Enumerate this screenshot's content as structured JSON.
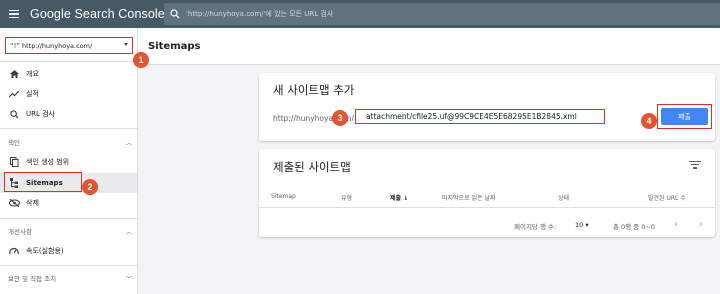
{
  "header": {
    "app_title": "Google Search Console",
    "search_placeholder": "'http://hunyhoya.com/'에 있는 모든 URL 검사"
  },
  "sidebar": {
    "property": "http://hunyhoya.com/",
    "items_top": [
      {
        "label": "개요",
        "icon": "home-icon"
      },
      {
        "label": "실적",
        "icon": "trending-icon"
      },
      {
        "label": "URL 검사",
        "icon": "search-icon"
      }
    ],
    "section_index": "색인",
    "items_index": [
      {
        "label": "색인 생성 범위",
        "icon": "file-copy-icon"
      },
      {
        "label": "Sitemaps",
        "icon": "sitemap-icon",
        "active": true
      },
      {
        "label": "삭제",
        "icon": "visibility-off-icon"
      }
    ],
    "section_improve": "개선사항",
    "items_improve": [
      {
        "label": "속도(실험용)",
        "icon": "speed-icon"
      }
    ],
    "section_security": "보안 및 직접 조치"
  },
  "page": {
    "title": "Sitemaps"
  },
  "add_card": {
    "title": "새 사이트맵 추가",
    "url_prefix": "http://hunyhoya.com/",
    "url_value": "attachment/cfile25.uf@99C9CE4E5E68295E1B2845.xml",
    "submit_label": "제출"
  },
  "submitted_card": {
    "title": "제출된 사이트맵",
    "columns": [
      "Sitemap",
      "유형",
      "제출",
      "마지막으로 읽은 날짜",
      "상태",
      "발견된 URL 수"
    ],
    "rows_per_page_label": "페이지당 행 수:",
    "rows_per_page_value": "10",
    "range_label": "총 0행 중 0~0"
  },
  "badges": [
    "1",
    "2",
    "3",
    "4"
  ],
  "colors": {
    "header_bg": "#455a64",
    "annotation_red": "#d93025",
    "badge": "#e5532f",
    "submit_blue": "#4285f4"
  }
}
